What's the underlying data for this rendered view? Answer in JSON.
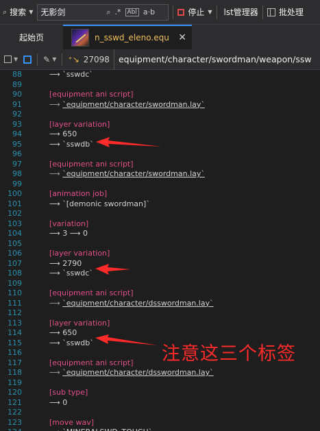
{
  "toolbar": {
    "search_label": "搜索",
    "search_value": "无影剑",
    "regex_icon": ".*",
    "case_icon": "Abl",
    "word_icon": "a·b",
    "stop_label": "停止",
    "lst_label": "lst管理器",
    "batch_label": "批处理"
  },
  "tabs": {
    "start_label": "起始页",
    "active_label": "n_sswd_eleno.equ",
    "close_glyph": "✕"
  },
  "subbar": {
    "count": "27098",
    "path": "equipment/character/swordman/weapon/ssw"
  },
  "code_lines": [
    {
      "n": "88",
      "parts": [
        {
          "t": "⟶ `sswdc`",
          "c": "t-str"
        }
      ]
    },
    {
      "n": "89",
      "parts": []
    },
    {
      "n": "90",
      "parts": [
        {
          "t": "[equipment ani script]",
          "c": "t-key"
        }
      ]
    },
    {
      "n": "91",
      "parts": [
        {
          "t": "⟶ ",
          "c": "t-arrow"
        },
        {
          "t": "`equipment/character/swordman.lay`",
          "c": "t-link"
        }
      ]
    },
    {
      "n": "92",
      "parts": []
    },
    {
      "n": "93",
      "parts": [
        {
          "t": "[layer variation]",
          "c": "t-key"
        }
      ]
    },
    {
      "n": "94",
      "parts": [
        {
          "t": "⟶ 650",
          "c": "t-num"
        }
      ]
    },
    {
      "n": "95",
      "parts": [
        {
          "t": "⟶ `sswdb`",
          "c": "t-str"
        }
      ]
    },
    {
      "n": "96",
      "parts": []
    },
    {
      "n": "97",
      "parts": [
        {
          "t": "[equipment ani script]",
          "c": "t-key"
        }
      ]
    },
    {
      "n": "98",
      "parts": [
        {
          "t": "⟶ ",
          "c": "t-arrow"
        },
        {
          "t": "`equipment/character/swordman.lay`",
          "c": "t-link"
        }
      ]
    },
    {
      "n": "99",
      "parts": []
    },
    {
      "n": "100",
      "parts": [
        {
          "t": "[animation job]",
          "c": "t-key"
        }
      ]
    },
    {
      "n": "101",
      "parts": [
        {
          "t": "⟶ `[demonic swordman]`",
          "c": "t-str"
        }
      ]
    },
    {
      "n": "102",
      "parts": []
    },
    {
      "n": "103",
      "parts": [
        {
          "t": "[variation]",
          "c": "t-key"
        }
      ]
    },
    {
      "n": "104",
      "parts": [
        {
          "t": "⟶ 3 ⟶ 0",
          "c": "t-num"
        }
      ]
    },
    {
      "n": "105",
      "parts": []
    },
    {
      "n": "106",
      "parts": [
        {
          "t": "[layer variation]",
          "c": "t-key"
        }
      ]
    },
    {
      "n": "107",
      "parts": [
        {
          "t": "⟶ 2790",
          "c": "t-num"
        }
      ]
    },
    {
      "n": "108",
      "parts": [
        {
          "t": "⟶ `sswdc`",
          "c": "t-str"
        }
      ]
    },
    {
      "n": "109",
      "parts": []
    },
    {
      "n": "110",
      "parts": [
        {
          "t": "[equipment ani script]",
          "c": "t-key"
        }
      ]
    },
    {
      "n": "111",
      "parts": [
        {
          "t": "⟶ ",
          "c": "t-arrow"
        },
        {
          "t": "`equipment/character/dsswordman.lay`",
          "c": "t-link"
        }
      ]
    },
    {
      "n": "112",
      "parts": []
    },
    {
      "n": "113",
      "parts": [
        {
          "t": "[layer variation]",
          "c": "t-key"
        }
      ]
    },
    {
      "n": "114",
      "parts": [
        {
          "t": "⟶ 650",
          "c": "t-num"
        }
      ]
    },
    {
      "n": "115",
      "parts": [
        {
          "t": "⟶ `sswdb`",
          "c": "t-str"
        }
      ]
    },
    {
      "n": "116",
      "parts": []
    },
    {
      "n": "117",
      "parts": [
        {
          "t": "[equipment ani script]",
          "c": "t-key"
        }
      ]
    },
    {
      "n": "118",
      "parts": [
        {
          "t": "⟶ ",
          "c": "t-arrow"
        },
        {
          "t": "`equipment/character/dsswordman.lay`",
          "c": "t-link"
        }
      ]
    },
    {
      "n": "119",
      "parts": []
    },
    {
      "n": "120",
      "parts": [
        {
          "t": "[sub type]",
          "c": "t-key"
        }
      ]
    },
    {
      "n": "121",
      "parts": [
        {
          "t": "⟶ 0",
          "c": "t-num"
        }
      ]
    },
    {
      "n": "122",
      "parts": []
    },
    {
      "n": "123",
      "parts": [
        {
          "t": "[move wav]",
          "c": "t-key"
        }
      ]
    },
    {
      "n": "124",
      "parts": [
        {
          "t": "⟶ `MINERALSWD_TOUCH`",
          "c": "t-str"
        }
      ]
    }
  ],
  "annotation": {
    "text": "注意这三个标签",
    "color": "#ff2a2a"
  }
}
